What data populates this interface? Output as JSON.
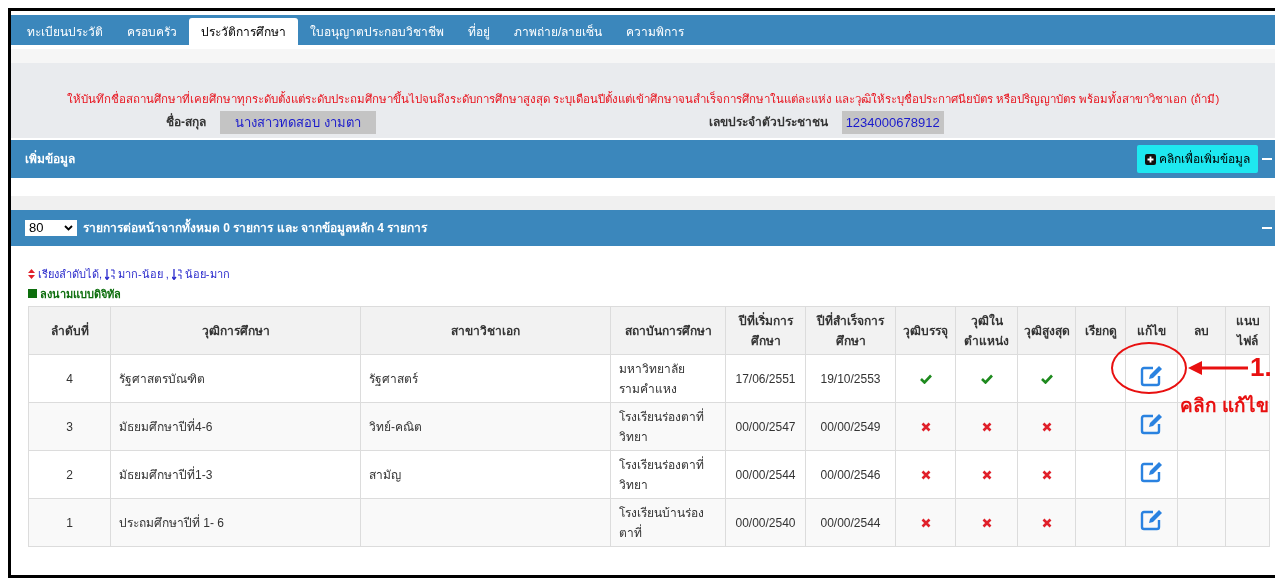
{
  "tabs": [
    {
      "label": "ทะเบียนประวัติ",
      "selected": false
    },
    {
      "label": "ครอบครัว",
      "selected": false
    },
    {
      "label": "ประวัติการศึกษา",
      "selected": true
    },
    {
      "label": "ใบอนุญาตประกอบวิชาชีพ",
      "selected": false
    },
    {
      "label": "ที่อยู่",
      "selected": false
    },
    {
      "label": "ภาพถ่าย/ลายเซ็น",
      "selected": false
    },
    {
      "label": "ความพิการ",
      "selected": false
    }
  ],
  "notice": "ให้บันทึกชื่อสถานศึกษาที่เคยศึกษาทุกระดับตั้งแต่ระดับประถมศึกษาขึ้นไปจนถึงระดับการศึกษาสูงสุด ระบุเดือนปีตั้งแต่เข้าศึกษาจนสำเร็จการศึกษาในแต่ละแห่ง และวุฒิให้ระบุชื่อประกาศนียบัตร หรือปริญญาบัตร พร้อมทั้งสาขาวิชาเอก (ถ้ามี)",
  "name_label": "ชื่อ-สกุล",
  "name_value": "นางสาวทดสอบ งามตา",
  "id_label": "เลขประจำตัวประชาชน",
  "id_value": "1234000678912",
  "add_panel": {
    "title": "เพิ่มข้อมูล",
    "button": "คลิกเพื่อเพิ่มข้อมูล"
  },
  "list_panel": {
    "page_size": "80",
    "summary": "รายการต่อหน้าจากทั้งหมด 0 รายการ และ จากข้อมูลหลัก 4 รายการ"
  },
  "sort_hint": {
    "sortable": "เรียงลำดับได้,",
    "desc": "มาก-น้อย ,",
    "asc": "น้อย-มาก"
  },
  "legend": "ลงนามแบบดิจิทัล",
  "table": {
    "columns": [
      "ลำดับที่",
      "วุฒิการศึกษา",
      "สาขาวิชาเอก",
      "สถาบันการศึกษา",
      "ปีที่เริ่มการศึกษา",
      "ปีที่สำเร็จการศึกษา",
      "วุฒิบรรจุ",
      "วุฒิในตำแหน่ง",
      "วุฒิสูงสุด",
      "เรียกดู",
      "แก้ไข",
      "ลบ",
      "แนบไฟล์"
    ],
    "rows": [
      {
        "no": "4",
        "degree": "รัฐศาสตรบัณฑิต",
        "major": "รัฐศาสตร์",
        "institution": "มหาวิทยาลัยรามคำแหง",
        "start": "17/06/2551",
        "end": "19/10/2553",
        "entry": true,
        "position": true,
        "highest": true
      },
      {
        "no": "3",
        "degree": "มัธยมศึกษาปีที่4-6",
        "major": "วิทย์-คณิต",
        "institution": "โรงเรียนร่องตาที่วิทยา",
        "start": "00/00/2547",
        "end": "00/00/2549",
        "entry": false,
        "position": false,
        "highest": false
      },
      {
        "no": "2",
        "degree": "มัธยมศึกษาปีที่1-3",
        "major": "สามัญ",
        "institution": "โรงเรียนร่องตาที่วิทยา",
        "start": "00/00/2544",
        "end": "00/00/2546",
        "entry": false,
        "position": false,
        "highest": false
      },
      {
        "no": "1",
        "degree": "ประถมศึกษาปีที่ 1- 6",
        "institution": "โรงเรียนบ้านร่องตาที่",
        "start": "00/00/2540",
        "end": "00/00/2544",
        "entry": false,
        "position": false,
        "highest": false
      }
    ]
  },
  "annotation": {
    "step": "1.",
    "text": "คลิก แก้ไข"
  }
}
